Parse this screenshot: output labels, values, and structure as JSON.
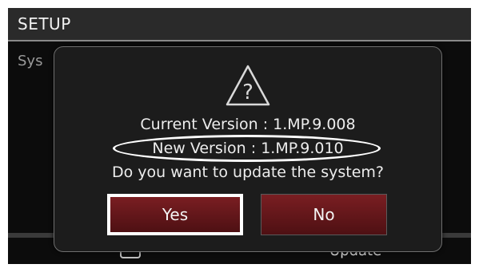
{
  "header": {
    "title": "SETUP"
  },
  "background": {
    "section_label": "Sys",
    "bottom_label": "Update"
  },
  "dialog": {
    "icon": "warning-question-icon",
    "current_version": "Current Version : 1.MP.9.008",
    "new_version": "New Version : 1.MP.9.010",
    "question": "Do you want to update the system?",
    "buttons": {
      "yes": "Yes",
      "no": "No"
    },
    "focused_button": "Yes"
  },
  "colors": {
    "screen_bg": "#0c0c0c",
    "dialog_bg": "#1c1c1c",
    "button_red": "#6a181c",
    "focus_border": "#ffffff"
  }
}
